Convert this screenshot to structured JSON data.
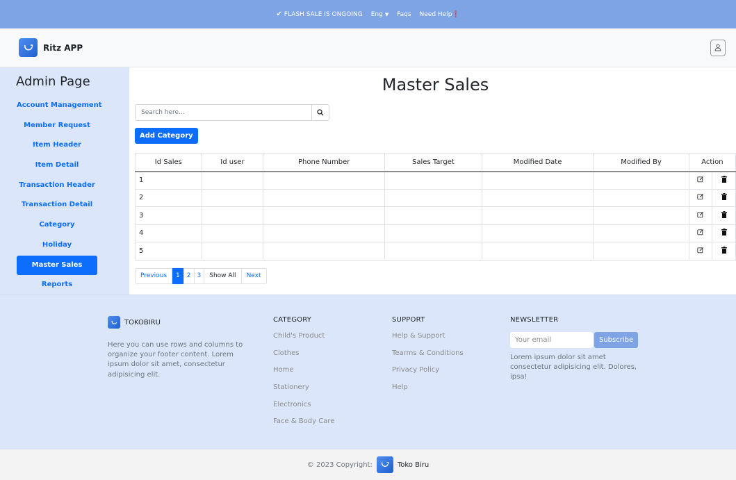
{
  "topbar": {
    "flash_sale": "FLASH SALE IS ONGOING",
    "language": "Eng",
    "faqs": "Faqs",
    "help": "Need Help❗"
  },
  "navbar": {
    "brand": "Ritz APP"
  },
  "sidebar": {
    "title": "Admin Page",
    "items": [
      {
        "label": "Account Management"
      },
      {
        "label": "Member Request"
      },
      {
        "label": "Item Header"
      },
      {
        "label": "Item Detail"
      },
      {
        "label": "Transaction Header"
      },
      {
        "label": "Transaction Detail"
      },
      {
        "label": "Category"
      },
      {
        "label": "Holiday"
      },
      {
        "label": "Master Sales"
      },
      {
        "label": "Reports"
      }
    ],
    "active": "Master Sales"
  },
  "main": {
    "title": "Master Sales",
    "search_placeholder": "Search here...",
    "add_button": "Add Category",
    "table": {
      "headers": [
        "Id Sales",
        "Id user",
        "Phone Number",
        "Sales Target",
        "Modified Date",
        "Modified By",
        "Action"
      ],
      "rows": [
        {
          "id": "1",
          "user": "",
          "phone": "",
          "target": "",
          "date": "",
          "by": ""
        },
        {
          "id": "2",
          "user": "",
          "phone": "",
          "target": "",
          "date": "",
          "by": ""
        },
        {
          "id": "3",
          "user": "",
          "phone": "",
          "target": "",
          "date": "",
          "by": ""
        },
        {
          "id": "4",
          "user": "",
          "phone": "",
          "target": "",
          "date": "",
          "by": ""
        },
        {
          "id": "5",
          "user": "",
          "phone": "",
          "target": "",
          "date": "",
          "by": ""
        }
      ]
    },
    "pagination": {
      "previous": "Previous",
      "pages": [
        "1",
        "2",
        "3"
      ],
      "current": "1",
      "show_all": "Show All",
      "next": "Next"
    }
  },
  "footer": {
    "brand": "TOKOBIRU",
    "about": "Here you can use rows and columns to organize your footer content. Lorem ipsum dolor sit amet, consectetur adipisicing elit.",
    "category": {
      "title": "CATEGORY",
      "links": [
        "Child's Product",
        "Clothes",
        "Home",
        "Stationery",
        "Electronics",
        "Face & Body Care"
      ]
    },
    "support": {
      "title": "SUPPORT",
      "links": [
        "Help & Support",
        "Tearms & Conditions",
        "Privacy Policy",
        "Help"
      ]
    },
    "newsletter": {
      "title": "NEWSLETTER",
      "placeholder": "Your email",
      "button": "Subscribe",
      "text": "Lorem ipsum dolor sit amet consectetur adipisicing elit. Dolores, ipsa!"
    },
    "copyright": "© 2023 Copyright:",
    "copyright_brand": "Toko Biru"
  },
  "colors": {
    "topbar": "#7ea4e6",
    "sidebar": "#dbe6fb",
    "primary": "#0d6efd",
    "footer": "#dbe6fb"
  }
}
